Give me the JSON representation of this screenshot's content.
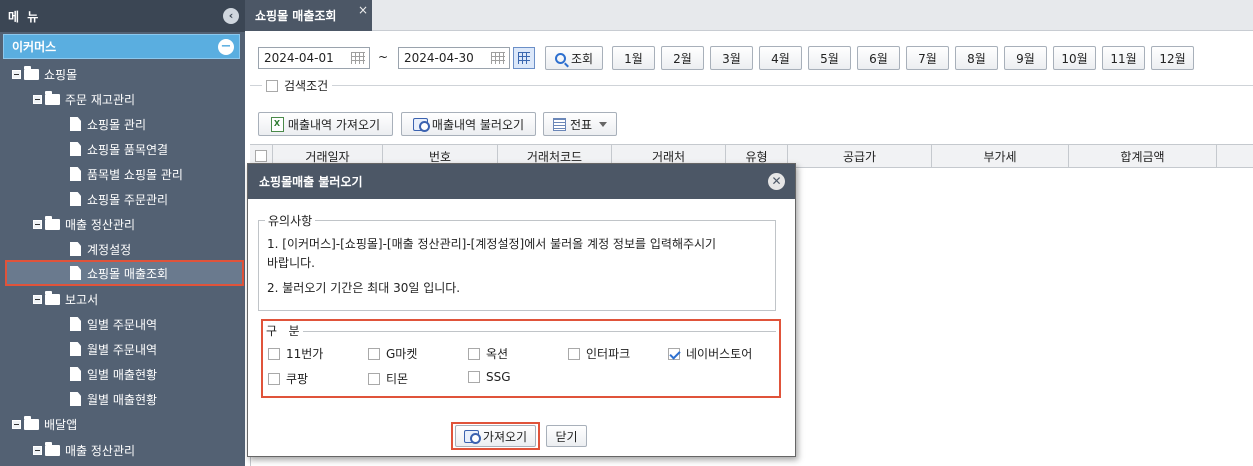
{
  "sidebar": {
    "header_title": "메 뉴",
    "collapse_icon": "chevron-left-icon",
    "section_title": "이커머스",
    "section_icon": "minus-circle-icon",
    "tree": [
      {
        "label": "쇼핑몰",
        "type": "folder",
        "level": 0
      },
      {
        "label": "주문 재고관리",
        "type": "folder",
        "level": 1
      },
      {
        "label": "쇼핑몰 관리",
        "type": "doc",
        "level": 2
      },
      {
        "label": "쇼핑몰 품목연결",
        "type": "doc",
        "level": 2
      },
      {
        "label": "품목별 쇼핑몰 관리",
        "type": "doc",
        "level": 2
      },
      {
        "label": "쇼핑몰 주문관리",
        "type": "doc",
        "level": 2
      },
      {
        "label": "매출 정산관리",
        "type": "folder",
        "level": 1
      },
      {
        "label": "계정설정",
        "type": "doc",
        "level": 2
      },
      {
        "label": "쇼핑몰 매출조회",
        "type": "doc",
        "level": 2,
        "selected": true
      },
      {
        "label": "보고서",
        "type": "folder",
        "level": 1
      },
      {
        "label": "일별 주문내역",
        "type": "doc",
        "level": 2
      },
      {
        "label": "월별 주문내역",
        "type": "doc",
        "level": 2
      },
      {
        "label": "일별 매출현황",
        "type": "doc",
        "level": 2
      },
      {
        "label": "월별 매출현황",
        "type": "doc",
        "level": 2
      },
      {
        "label": "배달앱",
        "type": "folder",
        "level": 0
      },
      {
        "label": "매출 정산관리",
        "type": "folder",
        "level": 1
      }
    ]
  },
  "tab": {
    "label": "쇼핑몰 매출조회",
    "close": "×"
  },
  "search": {
    "date_from": "2024-04-01",
    "separator": "~",
    "date_to": "2024-04-30",
    "search_button": "조회",
    "months": [
      "1월",
      "2월",
      "3월",
      "4월",
      "5월",
      "6월",
      "7월",
      "8월",
      "9월",
      "10월",
      "11월",
      "12월"
    ],
    "condition_label": "검색조건"
  },
  "toolbar": {
    "import_sales": "매출내역 가져오기",
    "load_sales": "매출내역 불러오기",
    "voucher": "전표"
  },
  "grid": {
    "columns": [
      "거래일자",
      "번호",
      "거래처코드",
      "거래처",
      "유형",
      "공급가",
      "부가세",
      "합계금액"
    ]
  },
  "dialog": {
    "title": "쇼핑몰매출 불러오기",
    "close_icon": "close-icon",
    "notice_legend": "유의사항",
    "notice_1a": "1. [이커머스]-[쇼핑몰]-[매출 정산관리]-[계정설정]에서 불러올 계정 정보를 입력해주시기",
    "notice_1b": "바랍니다.",
    "notice_2": "2. 불러오기 기간은 최대 30일 입니다.",
    "category_legend": "구   분",
    "options": [
      {
        "label": "11번가",
        "checked": false
      },
      {
        "label": "G마켓",
        "checked": false
      },
      {
        "label": "옥션",
        "checked": false
      },
      {
        "label": "인터파크",
        "checked": false
      },
      {
        "label": "네이버스토어",
        "checked": true
      },
      {
        "label": "쿠팡",
        "checked": false
      },
      {
        "label": "티몬",
        "checked": false
      },
      {
        "label": "SSG",
        "checked": false
      }
    ],
    "import_button": "가져오기",
    "close_button": "닫기"
  },
  "colors": {
    "sidebar_bg": "#536173",
    "header_bg": "#3b4654",
    "section_bg": "#5aaee0",
    "highlight": "#e0533a",
    "dialog_title_bg": "#4c5766"
  }
}
